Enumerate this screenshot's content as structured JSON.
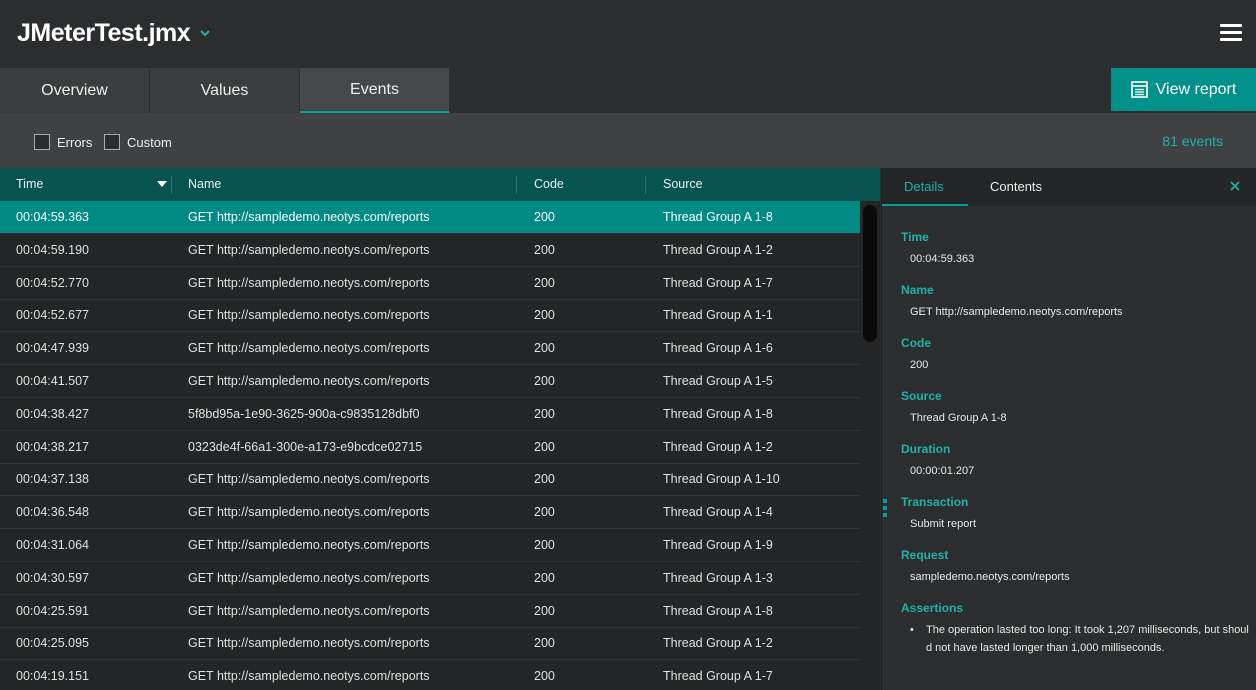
{
  "app": {
    "title": "JMeterTest.jmx"
  },
  "tabs": [
    {
      "label": "Overview"
    },
    {
      "label": "Values"
    },
    {
      "label": "Events"
    }
  ],
  "view_report": {
    "label": "View report"
  },
  "filters": {
    "errors_label": "Errors",
    "custom_label": "Custom",
    "events_count": "81 events"
  },
  "grid": {
    "columns": {
      "time": "Time",
      "name": "Name",
      "code": "Code",
      "source": "Source"
    },
    "rows": [
      {
        "time": "00:04:59.363",
        "name": "GET http://sampledemo.neotys.com/reports",
        "code": "200",
        "source": "Thread Group A 1-8"
      },
      {
        "time": "00:04:59.190",
        "name": "GET http://sampledemo.neotys.com/reports",
        "code": "200",
        "source": "Thread Group A 1-2"
      },
      {
        "time": "00:04:52.770",
        "name": "GET http://sampledemo.neotys.com/reports",
        "code": "200",
        "source": "Thread Group A 1-7"
      },
      {
        "time": "00:04:52.677",
        "name": "GET http://sampledemo.neotys.com/reports",
        "code": "200",
        "source": "Thread Group A 1-1"
      },
      {
        "time": "00:04:47.939",
        "name": "GET http://sampledemo.neotys.com/reports",
        "code": "200",
        "source": "Thread Group A 1-6"
      },
      {
        "time": "00:04:41.507",
        "name": "GET http://sampledemo.neotys.com/reports",
        "code": "200",
        "source": "Thread Group A 1-5"
      },
      {
        "time": "00:04:38.427",
        "name": "5f8bd95a-1e90-3625-900a-c9835128dbf0",
        "code": "200",
        "source": "Thread Group A 1-8"
      },
      {
        "time": "00:04:38.217",
        "name": "0323de4f-66a1-300e-a173-e9bcdce02715",
        "code": "200",
        "source": "Thread Group A 1-2"
      },
      {
        "time": "00:04:37.138",
        "name": "GET http://sampledemo.neotys.com/reports",
        "code": "200",
        "source": "Thread Group A 1-10"
      },
      {
        "time": "00:04:36.548",
        "name": "GET http://sampledemo.neotys.com/reports",
        "code": "200",
        "source": "Thread Group A 1-4"
      },
      {
        "time": "00:04:31.064",
        "name": "GET http://sampledemo.neotys.com/reports",
        "code": "200",
        "source": "Thread Group A 1-9"
      },
      {
        "time": "00:04:30.597",
        "name": "GET http://sampledemo.neotys.com/reports",
        "code": "200",
        "source": "Thread Group A 1-3"
      },
      {
        "time": "00:04:25.591",
        "name": "GET http://sampledemo.neotys.com/reports",
        "code": "200",
        "source": "Thread Group A 1-8"
      },
      {
        "time": "00:04:25.095",
        "name": "GET http://sampledemo.neotys.com/reports",
        "code": "200",
        "source": "Thread Group A 1-2"
      },
      {
        "time": "00:04:19.151",
        "name": "GET http://sampledemo.neotys.com/reports",
        "code": "200",
        "source": "Thread Group A 1-7"
      }
    ]
  },
  "detail": {
    "tabs": {
      "details": "Details",
      "contents": "Contents"
    },
    "time_label": "Time",
    "time_value": "00:04:59.363",
    "name_label": "Name",
    "name_value": "GET http://sampledemo.neotys.com/reports",
    "code_label": "Code",
    "code_value": "200",
    "source_label": "Source",
    "source_value": "Thread Group A 1-8",
    "duration_label": "Duration",
    "duration_value": "00:00:01.207",
    "transaction_label": "Transaction",
    "transaction_value": "Submit report",
    "request_label": "Request",
    "request_value": "sampledemo.neotys.com/reports",
    "assertions_label": "Assertions",
    "assertion_text": "The operation lasted too long: It took 1,207 milliseconds, but should not have lasted longer than 1,000 milliseconds."
  },
  "colors": {
    "accent": "#00918b",
    "selected_row": "#008a84",
    "header": "#06534f",
    "label": "#1eb3aa"
  }
}
